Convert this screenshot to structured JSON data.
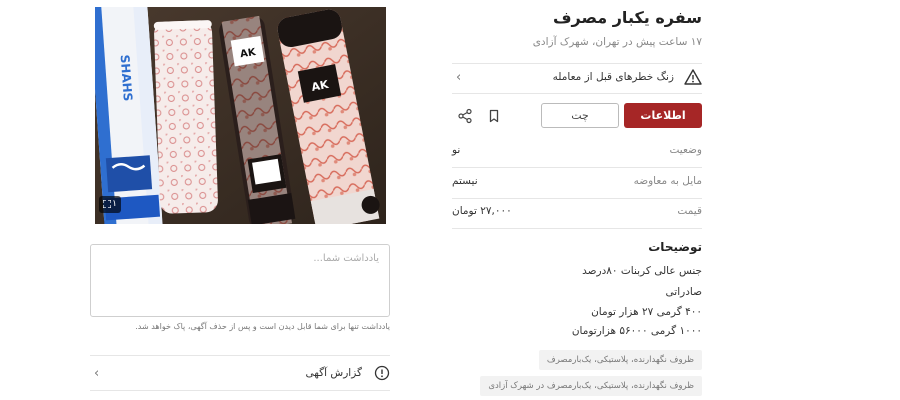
{
  "listing": {
    "title": "سفره یکبار مصرف",
    "subtitle": "۱۷ ساعت پیش در تهران، شهرک آزادی"
  },
  "warning": {
    "label": "زنگ خطرهای قبل از معامله",
    "icon": "warning-triangle-icon"
  },
  "actions": {
    "contact_label": "اطلاعات تماس",
    "chat_label": "چت",
    "bookmark_icon": "bookmark-icon",
    "share_icon": "share-icon",
    "accent_color": "#a62626"
  },
  "details": [
    {
      "key": "وضعیت",
      "value": "نو"
    },
    {
      "key": "مایل به معاوضه",
      "value": "نیستم"
    },
    {
      "key": "قیمت",
      "value": "۲۷,۰۰۰ تومان"
    }
  ],
  "description": {
    "title": "توضیحات",
    "lines": [
      "جنس عالی کربنات ۸۰درصد",
      "صادراتی",
      "۴۰۰ گرمی ۲۷ هزار تومان",
      "۱۰۰۰ گرمی ۵۶۰۰۰ هزارتومان"
    ]
  },
  "tags": [
    "ظروف نگهدارنده، پلاستیکی، یک‌بارمصرف",
    "ظروف نگهدارنده، پلاستیکی، یک‌بارمصرف در شهرک آزادی"
  ],
  "photo": {
    "count": "۱",
    "fullscreen_icon": "fullscreen-icon",
    "roll_labels": [
      "SHAHS",
      "AK",
      "AK"
    ]
  },
  "note": {
    "placeholder": "یادداشت شما...",
    "hint": "یادداشت تنها برای شما قابل دیدن است و پس از حذف آگهی، پاک خواهد شد."
  },
  "report": {
    "label": "گزارش آگهی",
    "icon": "info-circle-icon"
  }
}
